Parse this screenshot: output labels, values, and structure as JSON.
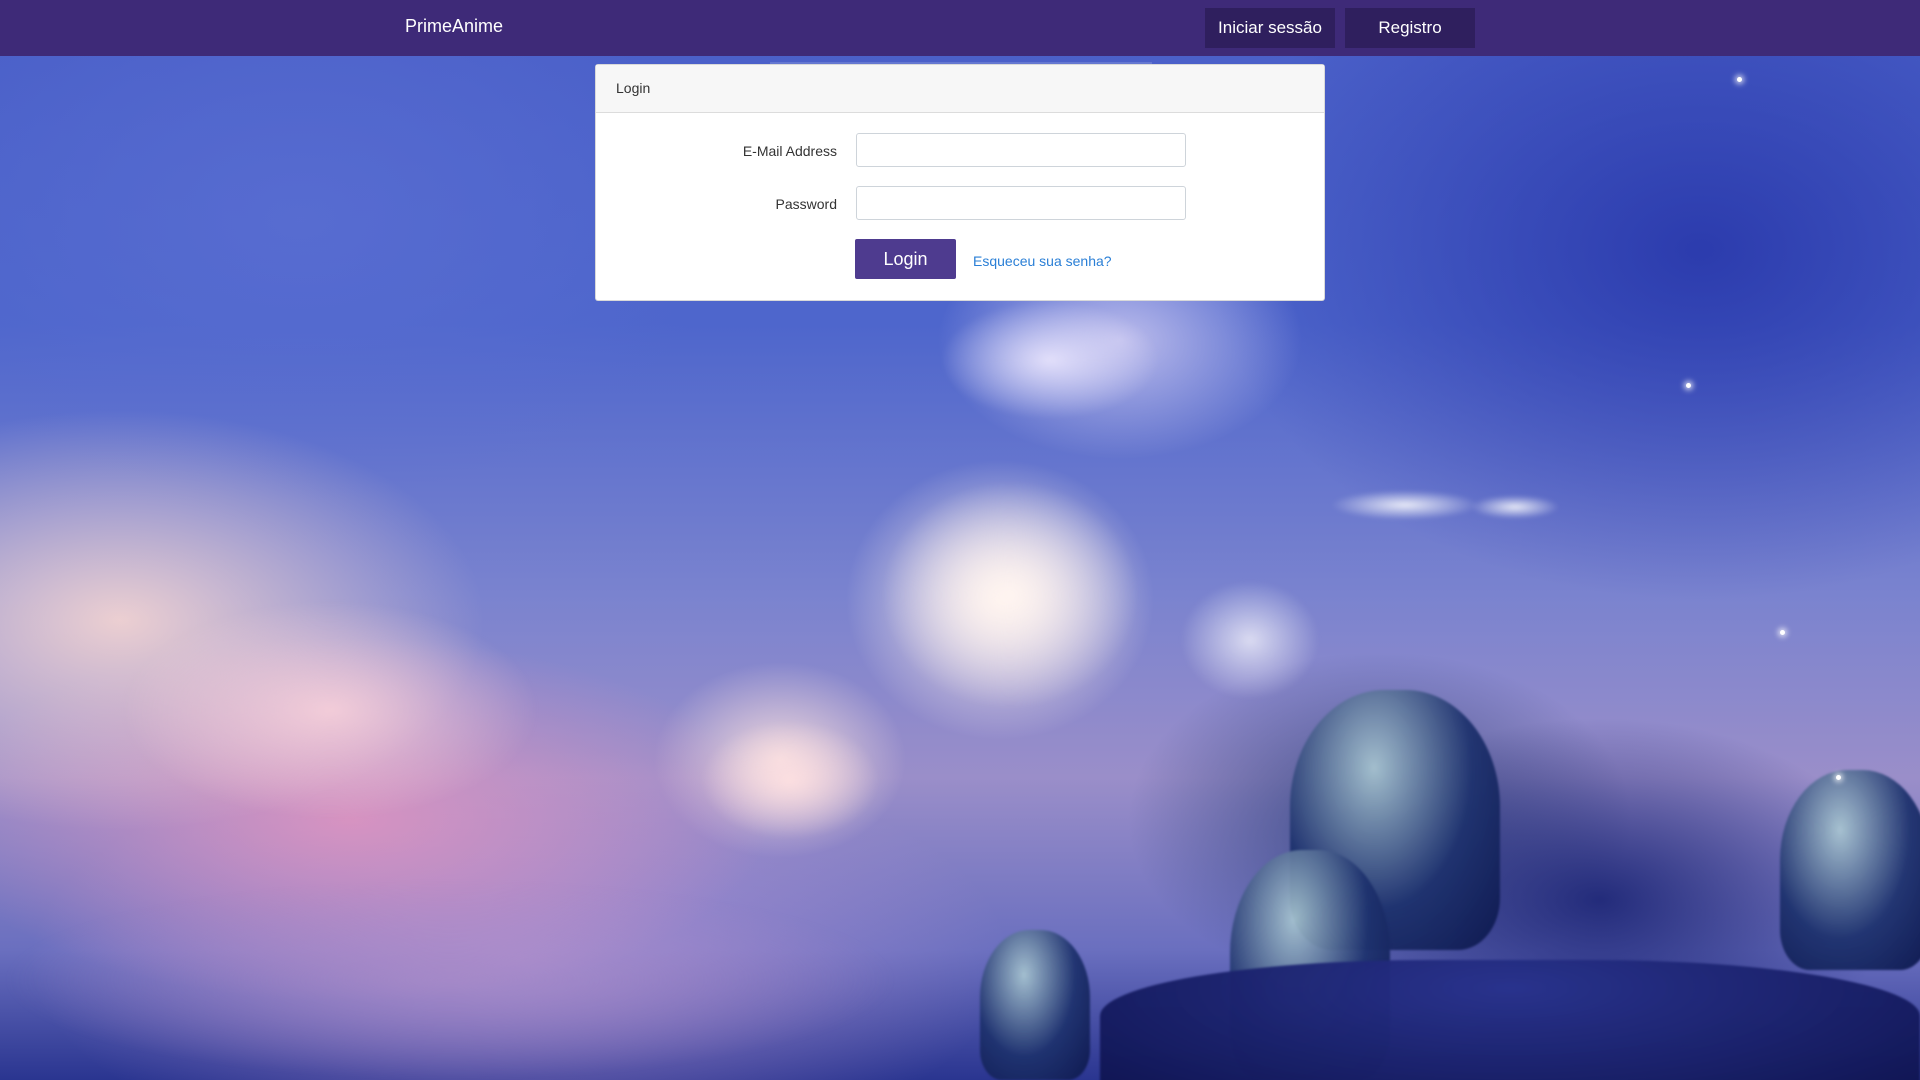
{
  "navbar": {
    "brand": "PrimeAnime",
    "login_label": "Iniciar sessão",
    "register_label": "Registro",
    "background_color": "#3e2a78"
  },
  "login_card": {
    "header": "Login",
    "email_label": "E-Mail Address",
    "email_value": "",
    "password_label": "Password",
    "password_value": "",
    "submit_label": "Login",
    "forgot_password_label": "Esqueceu sua senha?",
    "accent_color": "#4e3b8f",
    "link_color": "#2a7fd6"
  },
  "background": {
    "description_icon": "anime-sky-illustration"
  }
}
